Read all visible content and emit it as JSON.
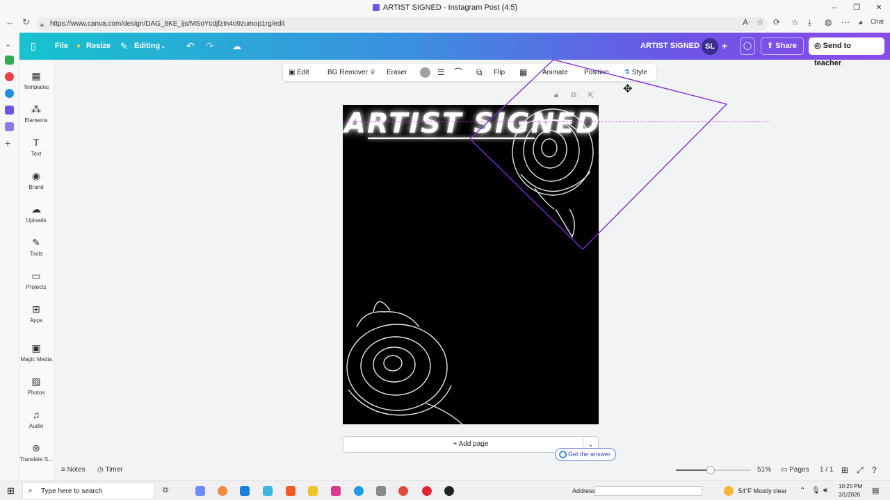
{
  "window": {
    "title": "ARTIST SIGNED - Instagram Post (4:5)",
    "controls": [
      "–",
      "❐",
      "✕"
    ]
  },
  "browser": {
    "url": "https://www.canva.com/design/DAG_8KE_ijs/MSoYcdjfzIn4o9zumop1rg/edit",
    "chat_label": "Chat"
  },
  "header": {
    "file": "File",
    "resize": "Resize",
    "editing": "Editing",
    "design_title": "ARTIST SIGNED",
    "avatar_initials": "SL",
    "share": "Share",
    "send_to_teacher": "Send to teacher"
  },
  "sidebar": {
    "items": [
      {
        "label": "Templates",
        "icon": "templates-icon",
        "glyph": "▦"
      },
      {
        "label": "Elements",
        "icon": "elements-icon",
        "glyph": "⁂"
      },
      {
        "label": "Text",
        "icon": "text-icon",
        "glyph": "T"
      },
      {
        "label": "Brand",
        "icon": "brand-icon",
        "glyph": "◉"
      },
      {
        "label": "Uploads",
        "icon": "uploads-icon",
        "glyph": "☁"
      },
      {
        "label": "Tools",
        "icon": "tools-icon",
        "glyph": "✎"
      },
      {
        "label": "Projects",
        "icon": "projects-icon",
        "glyph": "▭"
      },
      {
        "label": "Apps",
        "icon": "apps-icon",
        "glyph": "⊞"
      },
      {
        "label": "Magic Media",
        "icon": "magic-media-icon",
        "glyph": "▣"
      },
      {
        "label": "Photos",
        "icon": "photos-icon",
        "glyph": "▨"
      },
      {
        "label": "Audio",
        "icon": "audio-icon",
        "glyph": "♫"
      },
      {
        "label": "Translate S...",
        "icon": "translate-icon",
        "glyph": "⊛"
      }
    ]
  },
  "toolbar": {
    "edit": "Edit",
    "bg_remover": "BG Remover",
    "eraser": "Eraser",
    "flip": "Flip",
    "animate": "Animate",
    "position": "Position",
    "style": "Style"
  },
  "design": {
    "title_text": "ARTIST SIGNED"
  },
  "canvas": {
    "add_page": "+ Add page",
    "get_answer": "Get the answer"
  },
  "statusbar": {
    "notes": "Notes",
    "timer": "Timer",
    "zoom": "51%",
    "zoom_fraction": 0.51,
    "pages_label": "Pages",
    "page_count": "1 / 1"
  },
  "taskbar": {
    "search_placeholder": "Type here to search",
    "address_label": "Address",
    "weather": "54°F  Mostly clear",
    "time": "10:20 PM",
    "date": "3/1/2026"
  },
  "colors": {
    "header_start": "#17c3ce",
    "header_end": "#8a4be9",
    "selection": "#7b2fd6",
    "design_bg": "#000000"
  }
}
